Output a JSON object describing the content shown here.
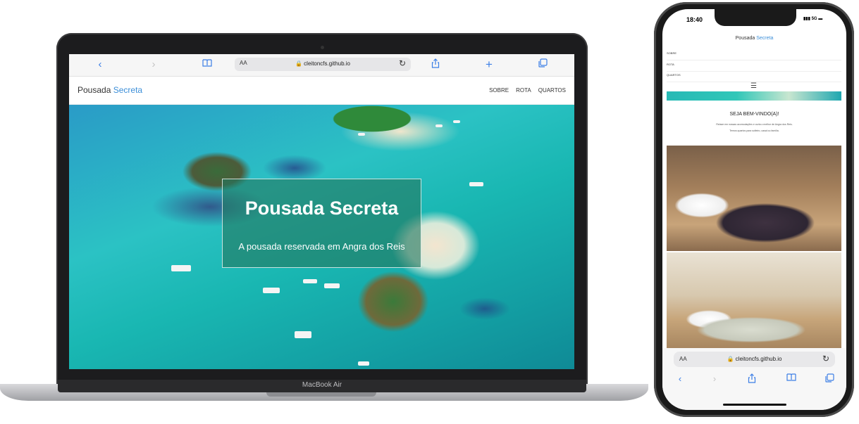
{
  "laptop": {
    "device_label": "MacBook Air",
    "safari": {
      "url": "🔒 cleitoncfs.github.io",
      "aa": "AA",
      "icons": [
        "back-icon",
        "forward-icon",
        "bookmarks-icon",
        "reload-icon",
        "share-icon",
        "new-tab-icon",
        "tabs-icon"
      ]
    },
    "site": {
      "brand_first": "Pousada ",
      "brand_accent": "Secreta",
      "nav": [
        "SOBRE",
        "ROTA",
        "QUARTOS"
      ],
      "hero_title": "Pousada Secreta",
      "hero_subtitle": "A pousada reservada em Angra dos Reis"
    }
  },
  "phone": {
    "status_time": "18:40",
    "status_right": "5G",
    "brand_first": "Pousada ",
    "brand_accent": "Secreta",
    "menu": [
      "SOBRE",
      "ROTA",
      "QUARTOS"
    ],
    "welcome": "SEJA BEM-VINDO(A)!",
    "intro_line1": "Relaxe em nossas acomodações e curta o melhor de Angra dos Reis.",
    "intro_line2": "Temos quartos para solteiro, casal ou família.",
    "safari": {
      "aa": "AA",
      "url": "🔒 cleitoncfs.github.io"
    }
  },
  "colors": {
    "accent": "#3b8ed8",
    "safari_blue": "#3d7fe6",
    "hero_box": "#23785f"
  }
}
